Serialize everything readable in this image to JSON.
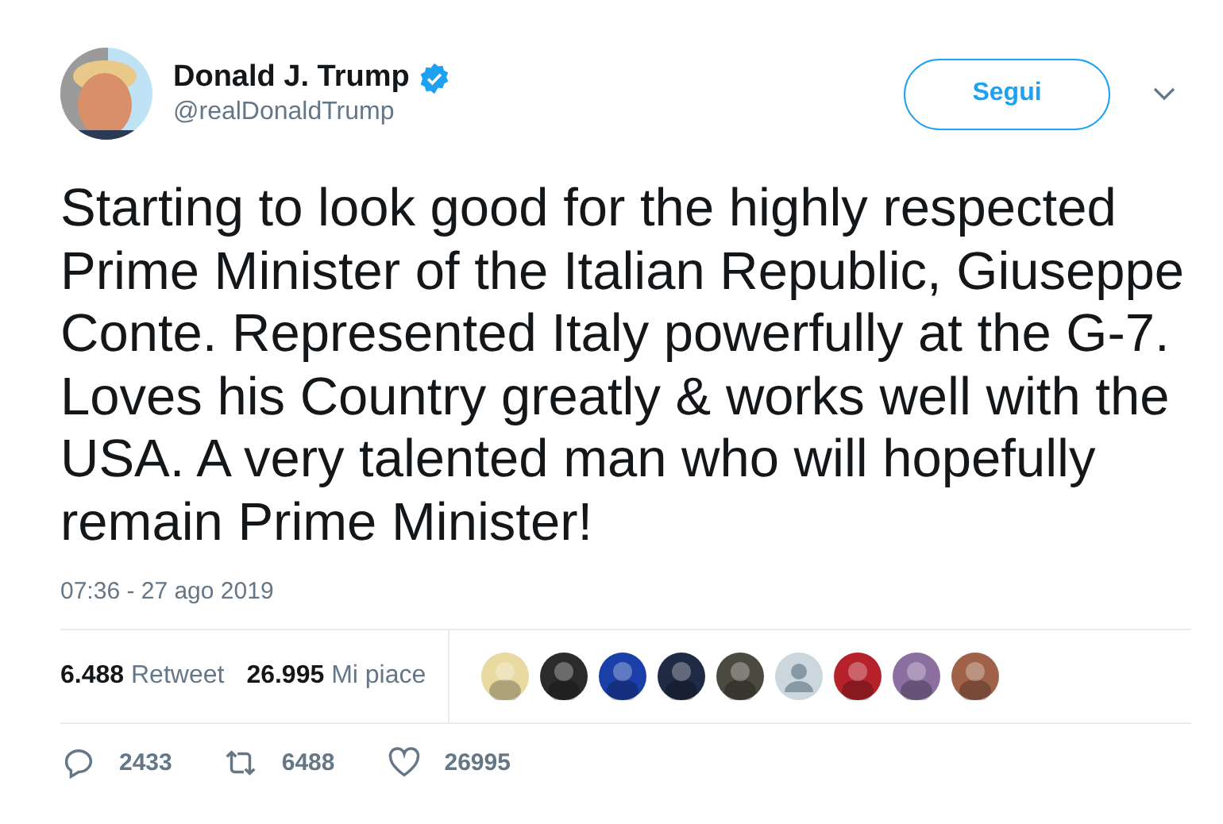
{
  "author": {
    "name": "Donald J. Trump",
    "verified": true,
    "handle": "@realDonaldTrump"
  },
  "follow_button": "Segui",
  "text": "Starting to look good for the highly respected Prime Minister of the Italian Republic, Giuseppe Conte. Represented Italy powerfully at the G-7. Loves his Country greatly & works well with the USA. A very talented man who will hopefully remain Prime Minister!",
  "timestamp": "07:36 - 27 ago 2019",
  "stats": [
    {
      "count": "6.488",
      "label": "Retweet"
    },
    {
      "count": "26.995",
      "label": "Mi piace"
    }
  ],
  "likers": [
    {
      "kind": "picture",
      "color": "#e8d9a0"
    },
    {
      "kind": "picture",
      "color": "#2b2b2b"
    },
    {
      "kind": "picture",
      "color": "#1a3fa8"
    },
    {
      "kind": "picture",
      "color": "#1f2a44"
    },
    {
      "kind": "picture",
      "color": "#4a4a40"
    },
    {
      "kind": "default",
      "color": "#ccd6dd"
    },
    {
      "kind": "picture",
      "color": "#b5222a"
    },
    {
      "kind": "picture",
      "color": "#8a6fa0"
    },
    {
      "kind": "picture",
      "color": "#a0634a"
    }
  ],
  "actions": [
    {
      "kind": "reply",
      "count": "2433"
    },
    {
      "kind": "retweet",
      "count": "6488"
    },
    {
      "kind": "like",
      "count": "26995"
    }
  ]
}
